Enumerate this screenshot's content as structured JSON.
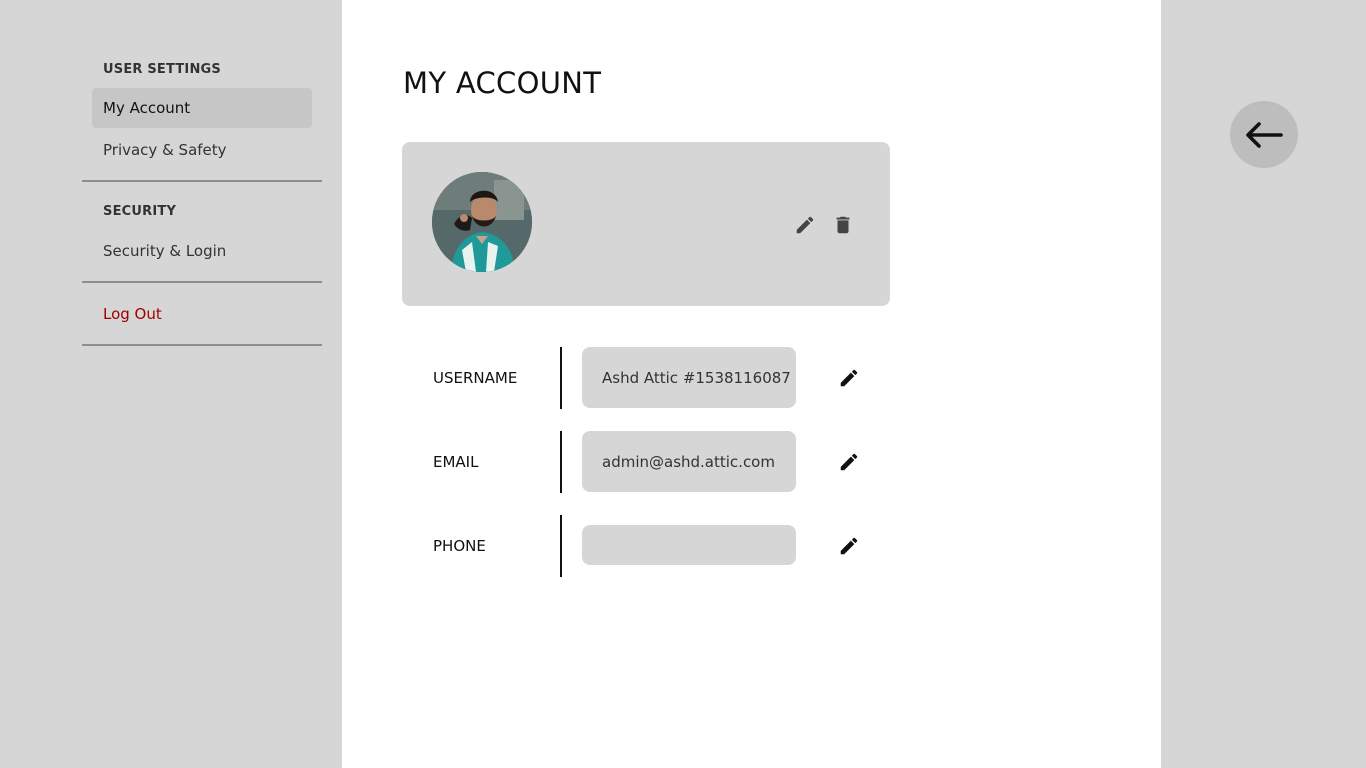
{
  "sidebar": {
    "sections": [
      {
        "title": "USER SETTINGS",
        "items": [
          "My Account",
          "Privacy & Safety"
        ]
      },
      {
        "title": "SECURITY",
        "items": [
          "Security & Login"
        ]
      }
    ],
    "logout_label": "Log Out",
    "active_item": "My Account"
  },
  "main": {
    "title": "MY ACCOUNT",
    "profile": {
      "edit_icon": "pencil-icon",
      "delete_icon": "trash-icon"
    },
    "fields": [
      {
        "label": "USERNAME",
        "value": "Ashd Attic #1538116087"
      },
      {
        "label": "EMAIL",
        "value": "admin@ashd.attic.com"
      },
      {
        "label": "PHONE",
        "value": ""
      }
    ]
  },
  "right_panel": {
    "back_icon": "arrow-left-icon"
  },
  "colors": {
    "panel_bg": "#d6d6d6",
    "main_bg": "#ffffff",
    "active_item_bg": "#c6c6c6",
    "logout_text": "#a00000",
    "back_button_bg": "#bdbdbd"
  }
}
